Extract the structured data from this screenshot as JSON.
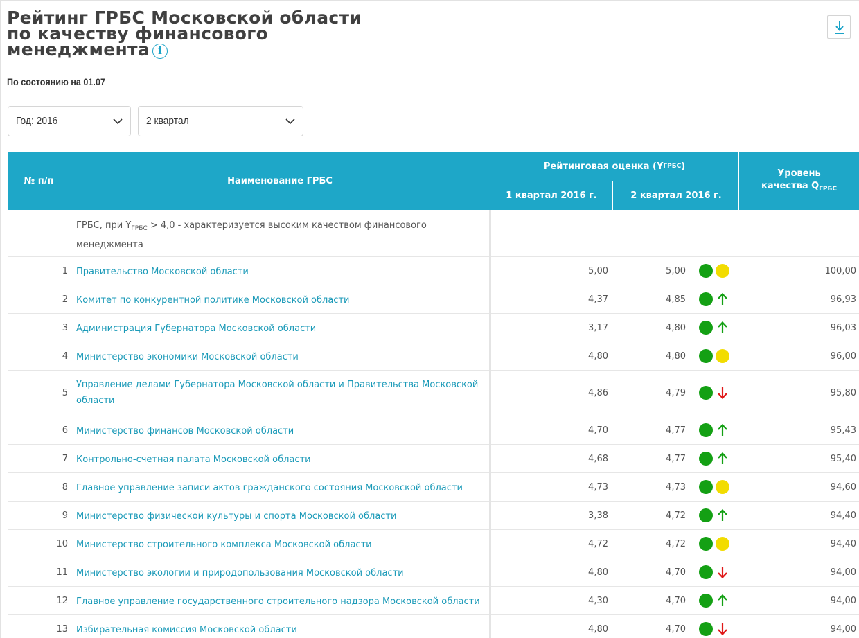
{
  "title": {
    "line1": "Рейтинг ГРБС Московской области",
    "line2": "по качеству финансового",
    "line3": "менеджмента",
    "info_glyph": "i"
  },
  "download_icon": "download-arrow-icon",
  "as_of": "По состоянию на 01.07",
  "filters": {
    "year": "Год: 2016",
    "quarter": "2 квартал"
  },
  "table": {
    "headers": {
      "num": "№ п/п",
      "name": "Наименование ГРБС",
      "rating": "Рейтинговая оценка (Y",
      "rating_sub": "ГРБС",
      "rating_end": ")",
      "q1": "1 квартал 2016 г.",
      "q2": "2 квартал 2016 г.",
      "level_line1": "Уровень",
      "level_line2": "качества Q",
      "level_sub": "ГРБС"
    },
    "group_row": {
      "text_a": "ГРБС, при Y",
      "text_sub": "ГРБС",
      "text_b": " > 4,0 - характеризуется высоким качеством финансового менеджмента"
    },
    "rows": [
      {
        "num": "1",
        "name": "Правительство Московской области",
        "q1": "5,00",
        "q2": "5,00",
        "trend": "same",
        "level": "100,00"
      },
      {
        "num": "2",
        "name": "Комитет по конкурентной политике Московской области",
        "q1": "4,37",
        "q2": "4,85",
        "trend": "up",
        "level": "96,93"
      },
      {
        "num": "3",
        "name": "Администрация Губернатора Московской области",
        "q1": "3,17",
        "q2": "4,80",
        "trend": "up",
        "level": "96,03"
      },
      {
        "num": "4",
        "name": "Министерство экономики Московской области",
        "q1": "4,80",
        "q2": "4,80",
        "trend": "same",
        "level": "96,00"
      },
      {
        "num": "5",
        "name": "Управление делами Губернатора Московской области и Правительства Московской области",
        "q1": "4,86",
        "q2": "4,79",
        "trend": "down",
        "level": "95,80"
      },
      {
        "num": "6",
        "name": "Министерство финансов Московской области",
        "q1": "4,70",
        "q2": "4,77",
        "trend": "up",
        "level": "95,43"
      },
      {
        "num": "7",
        "name": "Контрольно-счетная палата Московской области",
        "q1": "4,68",
        "q2": "4,77",
        "trend": "up",
        "level": "95,40"
      },
      {
        "num": "8",
        "name": "Главное управление записи актов гражданского состояния Московской области",
        "q1": "4,73",
        "q2": "4,73",
        "trend": "same",
        "level": "94,60"
      },
      {
        "num": "9",
        "name": "Министерство физической культуры и спорта Московской области",
        "q1": "3,38",
        "q2": "4,72",
        "trend": "up",
        "level": "94,40"
      },
      {
        "num": "10",
        "name": "Министерство строительного комплекса Московской области",
        "q1": "4,72",
        "q2": "4,72",
        "trend": "same",
        "level": "94,40"
      },
      {
        "num": "11",
        "name": "Министерство экологии и природопользования Московской области",
        "q1": "4,80",
        "q2": "4,70",
        "trend": "down",
        "level": "94,00"
      },
      {
        "num": "12",
        "name": "Главное управление государственного строительного надзора Московской области",
        "q1": "4,30",
        "q2": "4,70",
        "trend": "up",
        "level": "94,00"
      },
      {
        "num": "13",
        "name": "Избирательная комиссия Московской области",
        "q1": "4,80",
        "q2": "4,70",
        "trend": "down",
        "level": "94,00"
      }
    ]
  },
  "colors": {
    "header_bg": "#1ea7c8",
    "link": "#1b9ab8",
    "status_green": "#14a014",
    "trend_same": "#f2dc00",
    "trend_up": "#14a014",
    "trend_down": "#e01818"
  }
}
